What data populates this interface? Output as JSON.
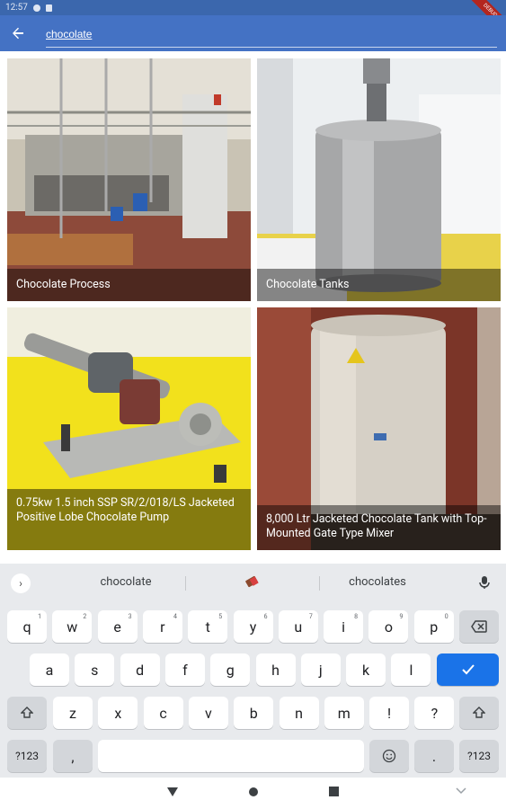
{
  "status_bar": {
    "time": "12:57"
  },
  "debug_banner": "DEBUG",
  "app_bar": {
    "search_value": "chocolate"
  },
  "results": [
    {
      "caption": "Chocolate Process"
    },
    {
      "caption": "Chocolate Tanks"
    },
    {
      "caption": "0.75kw 1.5 inch SSP SR/2/018/LS Jacketed Positive Lobe Chocolate Pump"
    },
    {
      "caption": "8,000 Ltr Jacketed Chocolate Tank with Top-Mounted Gate Type Mixer"
    }
  ],
  "keyboard": {
    "suggestions": [
      "chocolate",
      "chocolates"
    ],
    "row1": [
      "q",
      "w",
      "e",
      "r",
      "t",
      "y",
      "u",
      "i",
      "o",
      "p"
    ],
    "row1_hints": [
      "1",
      "2",
      "3",
      "4",
      "5",
      "6",
      "7",
      "8",
      "9",
      "0"
    ],
    "row2": [
      "a",
      "s",
      "d",
      "f",
      "g",
      "h",
      "j",
      "k",
      "l"
    ],
    "row3": [
      "z",
      "x",
      "c",
      "v",
      "b",
      "n",
      "m",
      "!",
      "?"
    ],
    "symbols_label": "?123",
    "comma": ",",
    "period": "."
  },
  "colors": {
    "app_bar": "#4472c4",
    "status_bar": "#3b67ad",
    "accent": "#1a73e8"
  },
  "icons": [
    "back-arrow-icon",
    "expand-suggestions-icon",
    "mic-icon",
    "backspace-icon",
    "checkmark-icon",
    "shift-icon",
    "emoji-icon",
    "nav-back-icon",
    "nav-home-icon",
    "nav-recents-icon",
    "keyboard-hide-icon"
  ]
}
